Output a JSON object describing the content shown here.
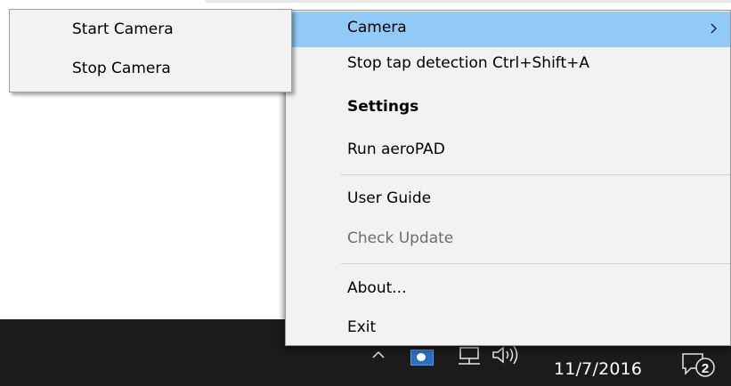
{
  "submenu": {
    "items": [
      {
        "label": "Start Camera"
      },
      {
        "label": "Stop Camera"
      }
    ]
  },
  "menu": {
    "items": [
      {
        "label": "Camera",
        "state": "highlighted",
        "has_submenu": true
      },
      {
        "label": "Stop tap detection Ctrl+Shift+A"
      },
      {
        "label": "Settings",
        "style": "bold"
      },
      {
        "label": "Run aeroPAD"
      },
      {
        "label": "User Guide"
      },
      {
        "label": "Check Update",
        "state": "disabled"
      },
      {
        "label": "About..."
      },
      {
        "label": "Exit"
      }
    ]
  },
  "taskbar": {
    "date": "11/7/2016",
    "notification_count": "2",
    "icons": [
      "chevron-up-icon",
      "app-tray-icon",
      "network-icon",
      "volume-icon",
      "notification-icon"
    ]
  },
  "colors": {
    "menu_background": "#f2f2f2",
    "highlight": "#91c9f7",
    "taskbar": "#1b1b1b",
    "disabled_text": "#6d6d6d"
  }
}
